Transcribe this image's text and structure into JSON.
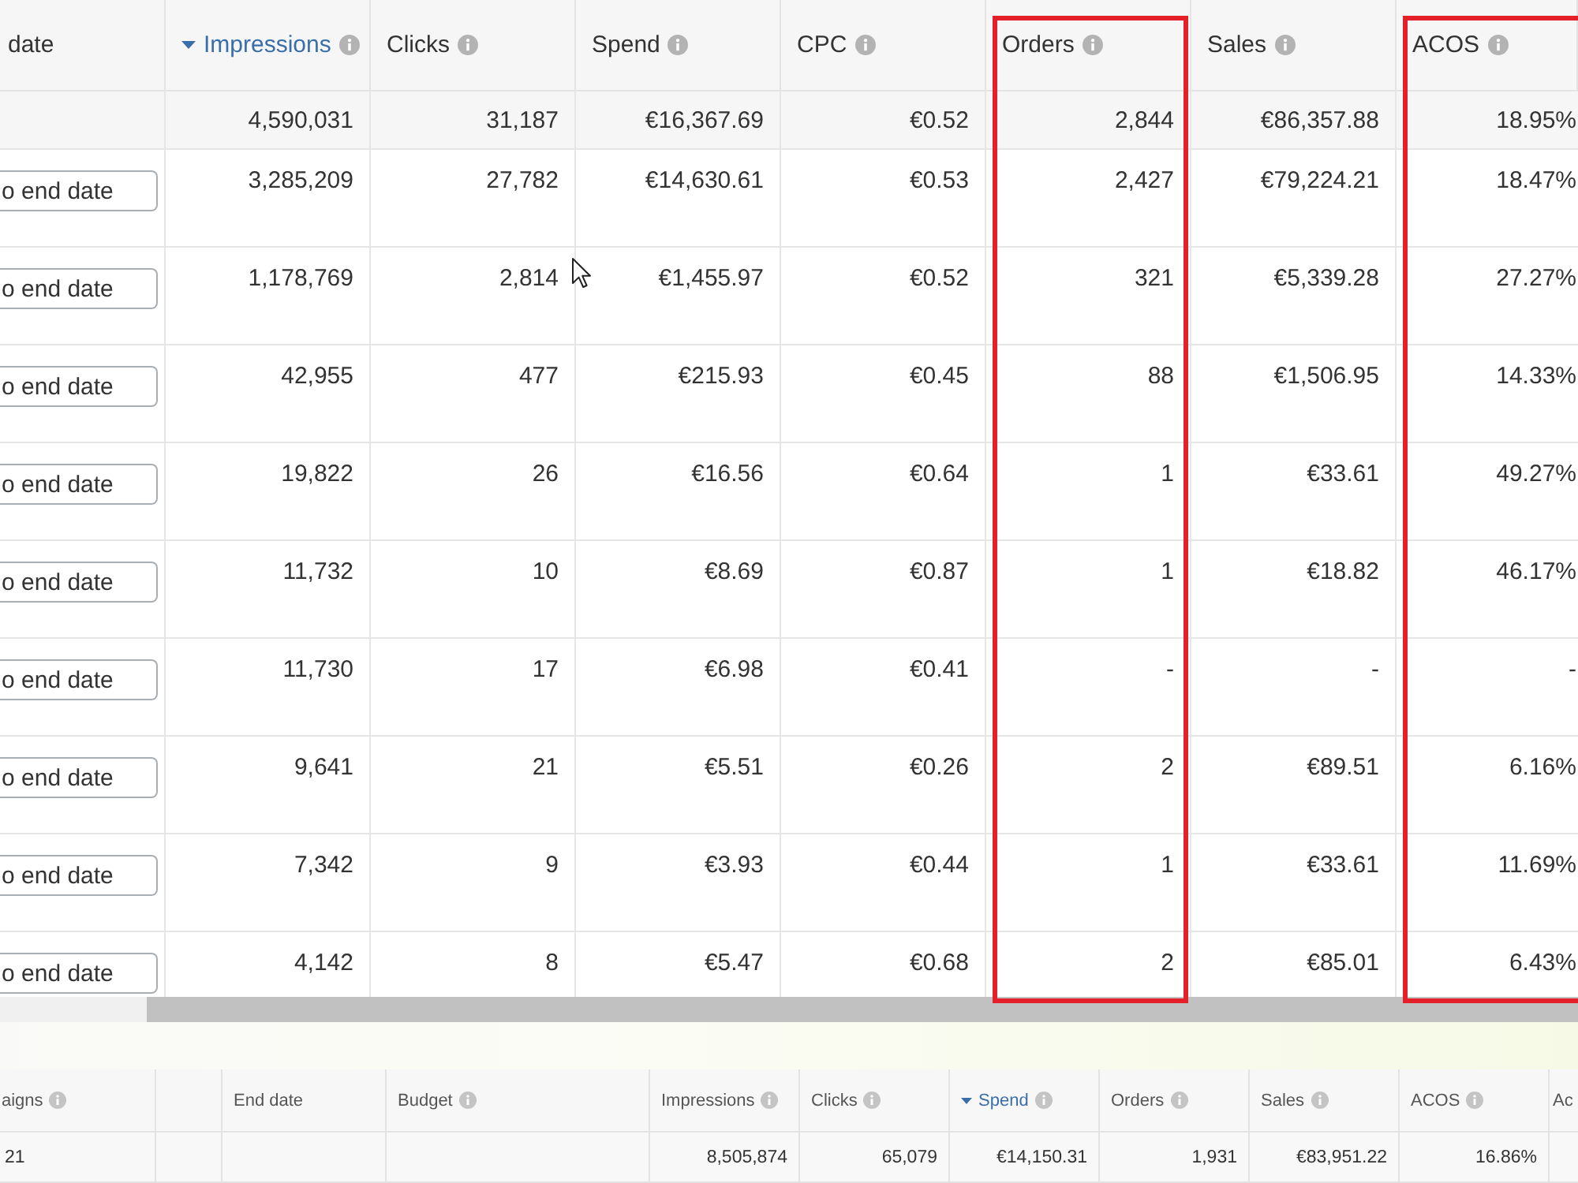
{
  "top_table": {
    "columns": [
      {
        "label": "date",
        "kind": "button",
        "info": false,
        "sorted": false,
        "highlighted": false
      },
      {
        "label": "Impressions",
        "kind": "number",
        "info": true,
        "sorted": true,
        "highlighted": false
      },
      {
        "label": "Clicks",
        "kind": "number",
        "info": true,
        "sorted": false,
        "highlighted": false
      },
      {
        "label": "Spend",
        "kind": "number",
        "info": true,
        "sorted": false,
        "highlighted": false
      },
      {
        "label": "CPC",
        "kind": "number",
        "info": true,
        "sorted": false,
        "highlighted": false
      },
      {
        "label": "Orders",
        "kind": "number",
        "info": true,
        "sorted": false,
        "highlighted": true
      },
      {
        "label": "Sales",
        "kind": "number",
        "info": true,
        "sorted": false,
        "highlighted": false
      },
      {
        "label": "ACOS",
        "kind": "number",
        "info": true,
        "sorted": false,
        "highlighted": true
      }
    ],
    "total_row": {
      "cells": [
        "",
        "4,590,031",
        "31,187",
        "€16,367.69",
        "€0.52",
        "2,844",
        "€86,357.88",
        "18.95%"
      ]
    },
    "rows": [
      {
        "cells": [
          "o end date",
          "3,285,209",
          "27,782",
          "€14,630.61",
          "€0.53",
          "2,427",
          "€79,224.21",
          "18.47%"
        ]
      },
      {
        "cells": [
          "o end date",
          "1,178,769",
          "2,814",
          "€1,455.97",
          "€0.52",
          "321",
          "€5,339.28",
          "27.27%"
        ]
      },
      {
        "cells": [
          "o end date",
          "42,955",
          "477",
          "€215.93",
          "€0.45",
          "88",
          "€1,506.95",
          "14.33%"
        ]
      },
      {
        "cells": [
          "o end date",
          "19,822",
          "26",
          "€16.56",
          "€0.64",
          "1",
          "€33.61",
          "49.27%"
        ]
      },
      {
        "cells": [
          "o end date",
          "11,732",
          "10",
          "€8.69",
          "€0.87",
          "1",
          "€18.82",
          "46.17%"
        ]
      },
      {
        "cells": [
          "o end date",
          "11,730",
          "17",
          "€6.98",
          "€0.41",
          "-",
          "-",
          "-"
        ]
      },
      {
        "cells": [
          "o end date",
          "9,641",
          "21",
          "€5.51",
          "€0.26",
          "2",
          "€89.51",
          "6.16%"
        ]
      },
      {
        "cells": [
          "o end date",
          "7,342",
          "9",
          "€3.93",
          "€0.44",
          "1",
          "€33.61",
          "11.69%"
        ]
      },
      {
        "cells": [
          "o end date",
          "4,142",
          "8",
          "€5.47",
          "€0.68",
          "2",
          "€85.01",
          "6.43%"
        ]
      }
    ]
  },
  "bottom_table": {
    "columns": [
      {
        "label": "aigns",
        "info": true,
        "sorted": false
      },
      {
        "info": false,
        "sorted": false
      },
      {
        "label": "End date",
        "info": false,
        "sorted": false
      },
      {
        "label": "Budget",
        "info": true,
        "sorted": false
      },
      {
        "label": "Impressions",
        "info": true,
        "sorted": false
      },
      {
        "label": "Clicks",
        "info": true,
        "sorted": false
      },
      {
        "label": "Spend",
        "info": true,
        "sorted": true
      },
      {
        "label": "Orders",
        "info": true,
        "sorted": false
      },
      {
        "label": "Sales",
        "info": true,
        "sorted": false
      },
      {
        "label": "ACOS",
        "info": true,
        "sorted": false
      },
      {
        "label": "Ac",
        "info": false,
        "sorted": false
      }
    ],
    "rows": [
      {
        "cells": [
          "21",
          "",
          "",
          "",
          "8,505,874",
          "65,079",
          "€14,150.31",
          "1,931",
          "€83,951.22",
          "16.86%",
          ""
        ]
      }
    ]
  }
}
